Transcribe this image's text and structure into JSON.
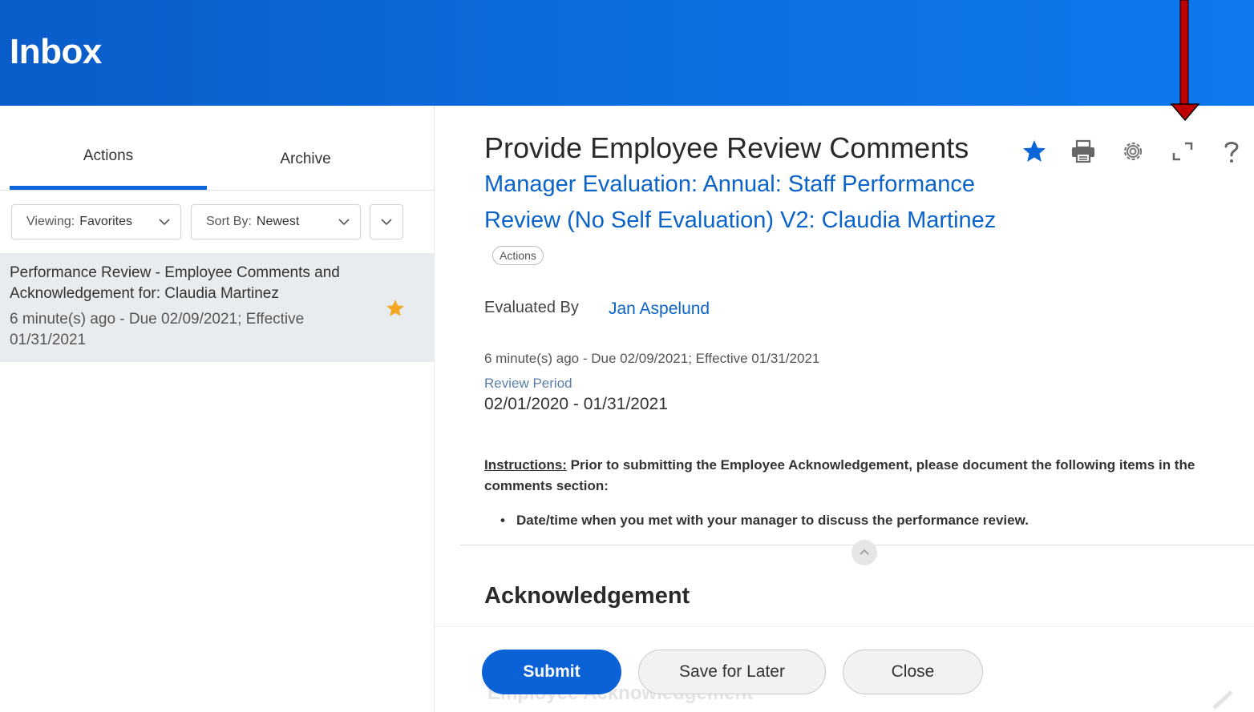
{
  "header": {
    "title": "Inbox"
  },
  "tabs": [
    {
      "label": "Actions",
      "active": true
    },
    {
      "label": "Archive",
      "active": false
    }
  ],
  "filters": {
    "viewing_label": "Viewing:",
    "viewing_value": "Favorites",
    "sort_label": "Sort By:",
    "sort_value": "Newest"
  },
  "inbox_items": [
    {
      "title": "Performance Review - Employee Comments and Acknowledgement for: Claudia Martinez",
      "meta": "6 minute(s) ago - Due 02/09/2021; Effective 01/31/2021",
      "favorite": true
    }
  ],
  "detail": {
    "title": "Provide Employee Review Comments",
    "subtitle": "Manager Evaluation: Annual: Staff Performance Review (No Self Evaluation) V2: Claudia Martinez",
    "actions_pill": "Actions",
    "evaluated_by_label": "Evaluated By",
    "evaluated_by_value": "Jan Aspelund",
    "meta": "6 minute(s) ago - Due 02/09/2021; Effective 01/31/2021",
    "review_period_label": "Review Period",
    "review_period_value": "02/01/2020 - 01/31/2021",
    "instructions_label": "Instructions:",
    "instructions_text": " Prior to submitting the Employee Acknowledgement, please document the following items in the comments section:",
    "bullet": "Date/time when you met with your manager to discuss the performance review.",
    "section_heading": "Acknowledgement",
    "ghost_text": "Employee Acknowledgement"
  },
  "toolbar_icons": [
    "star-icon",
    "print-icon",
    "gear-icon",
    "expand-icon",
    "help-icon"
  ],
  "buttons": {
    "submit": "Submit",
    "save_for_later": "Save for Later",
    "close": "Close"
  },
  "colors": {
    "brand_blue": "#0a5cc8",
    "link_blue": "#0a63c9",
    "favorite_orange": "#f5a623",
    "annotation_red": "#c00000"
  }
}
